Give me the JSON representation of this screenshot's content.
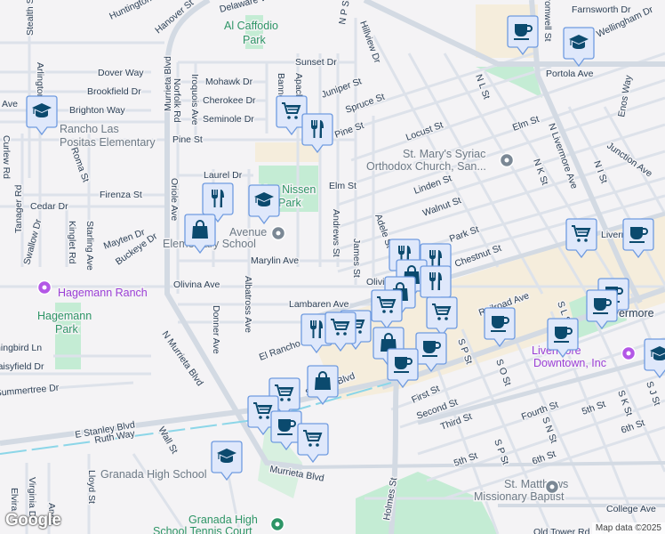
{
  "map": {
    "attribution": "Map data ©2025",
    "logo": "Google",
    "colors": {
      "marker_fill": "#dfe8fb",
      "marker_stroke": "#6f9be0",
      "marker_icon": "#0b4a6e",
      "park": "#c4ecd4",
      "commercial": "#f5eddc",
      "road": "#d9dfe7"
    }
  },
  "labels": [
    "Huntington Way",
    "Hanover St",
    "Delaware Way",
    "Stealth St",
    "Dover Way",
    "Brookfield Dr",
    "Brighton Way",
    "Arlington",
    "Ave",
    "Murrieta Blvd",
    "Norfolk Rd",
    "Iroquois Ave",
    "Mohawk Dr",
    "Cherokee Dr",
    "Seminole Dr",
    "Sunset Dr",
    "Bannock",
    "Apache Ave",
    "Pine St",
    "Curlew Rd",
    "Roma St",
    "Laurel Dr",
    "Oriole Ave",
    "Firenza St",
    "Cedar Dr",
    "Tanager Rd",
    "Swallow Dr",
    "Kinglet Rd",
    "Starling Ave",
    "Mayten Dr",
    "Buckeye Dr",
    "Marylin Ave",
    "Andrews St",
    "James St",
    "Adele St",
    "Elm St",
    "Juniper St",
    "Spruce St",
    "Pine St",
    "Locust St",
    "Linden St",
    "Walnut St",
    "Elm St",
    "N L St",
    "N P St",
    "Hillview Dr",
    "N K St",
    "N Livermore Ave",
    "N I St",
    "Junction Ave",
    "Enos Way",
    "Portola Ave",
    "Farnsworth Dr",
    "Wellingham Dr",
    "Cromwell St",
    "Olivina Ave",
    "Lambaren Ave",
    "Olivina",
    "Chestnut St",
    "Park St",
    "Railroad Ave",
    "Donner Ave",
    "Albatross Ave",
    "El Rancho Dr",
    "N Murrieta Blvd",
    "Hummingbird Ln",
    "Daisyfield Dr",
    "Summertree Dr",
    "E Stanley Blvd",
    "Ruth Way",
    "Wall St",
    "Stanley Blvd",
    "Lloyd St",
    "Virginia Dr",
    "Elvira",
    "Anne",
    "Murrieta Blvd",
    "First St",
    "Second St",
    "Third St",
    "Fourth St",
    "5th St",
    "6th St",
    "5th St",
    "6th St",
    "S P St",
    "S O St",
    "S N St",
    "S P St",
    "S L St",
    "S K St",
    "S J St",
    "Holmes St",
    "College Ave",
    "Old Tower Rd",
    "Livermore",
    "Livermore"
  ],
  "places": {
    "al_caffodio": [
      "Al Caffodio",
      "Park"
    ],
    "may_nissen": [
      "May Nissen",
      "Park"
    ],
    "hagemann_park": [
      "Hagemann",
      "Park"
    ],
    "rancho": [
      "Rancho Las",
      "Positas Elementary"
    ],
    "avenue_school": [
      "Avenue",
      "Elementary School"
    ],
    "st_marys": [
      "St. Mary's Syriac",
      "Orthodox Church, San..."
    ],
    "hagemann_ranch": "Hagemann Ranch",
    "granada_high": "Granada High School",
    "tennis": [
      "Granada High",
      "School Tennis Court"
    ],
    "downtown": [
      "Livermore",
      "Downtown, Inc"
    ],
    "st_matthews": [
      "St. Matthews",
      "Missionary Baptist"
    ]
  },
  "markers": [
    "cafe",
    "school",
    "school",
    "grocery",
    "restaurant",
    "restaurant",
    "school",
    "shopping",
    "grocery",
    "cafe",
    "restaurant",
    "restaurant",
    "shopping",
    "restaurant",
    "shopping",
    "grocery",
    "grocery",
    "cafe",
    "cafe",
    "cafe",
    "cafe",
    "school",
    "cafe",
    "shopping",
    "cafe",
    "restaurant",
    "grocery",
    "grocery",
    "shopping",
    "grocery",
    "grocery",
    "cafe",
    "grocery",
    "school"
  ]
}
